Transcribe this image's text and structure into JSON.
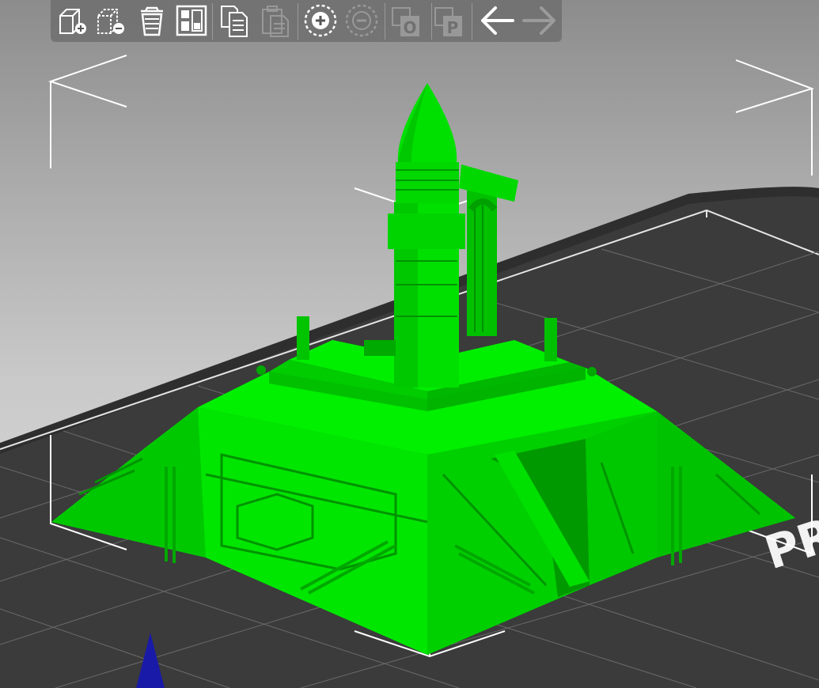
{
  "app": {
    "viewport": "3d-plater"
  },
  "toolbar": {
    "buttons": [
      {
        "name": "add-button",
        "icon": "add-object-icon",
        "enabled": true
      },
      {
        "name": "delete-button",
        "icon": "delete-object-icon",
        "enabled": true
      },
      {
        "name": "delete-all-button",
        "icon": "trash-icon",
        "enabled": true
      },
      {
        "name": "arrange-button",
        "icon": "arrange-icon",
        "enabled": true
      },
      {
        "name": "copy-button",
        "icon": "copy-icon",
        "enabled": true
      },
      {
        "name": "paste-button",
        "icon": "paste-icon",
        "enabled": false
      },
      {
        "name": "add-instance-button",
        "icon": "plus-circle-icon",
        "enabled": true
      },
      {
        "name": "remove-instance-button",
        "icon": "minus-circle-icon",
        "enabled": false
      },
      {
        "name": "split-objects-button",
        "icon": "split-objects-icon",
        "label": "O",
        "enabled": false
      },
      {
        "name": "split-parts-button",
        "icon": "split-parts-icon",
        "label": "P",
        "enabled": false
      },
      {
        "name": "undo-button",
        "icon": "arrow-left-icon",
        "enabled": true
      },
      {
        "name": "redo-button",
        "icon": "arrow-right-icon",
        "enabled": false
      }
    ]
  },
  "bed": {
    "logo_text": "PR",
    "color": "#3b3b3b"
  },
  "model": {
    "color": "#00e000",
    "selected": true
  },
  "colors": {
    "model_green": "#00e000",
    "bed_dark": "#3b3b3b",
    "selection_box": "#ffffff",
    "axis_z": "#1a1aa8"
  }
}
